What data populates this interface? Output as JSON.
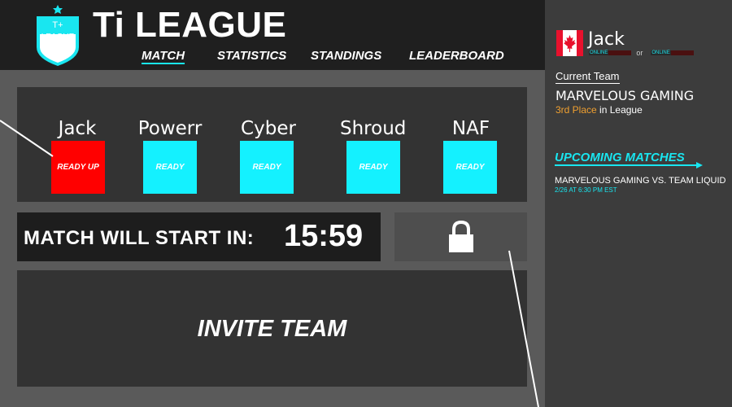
{
  "header": {
    "logo_top": "T+",
    "logo_text": "LEAGUE",
    "title": "Ti LEAGUE",
    "nav": {
      "match": "MATCH",
      "statistics": "STATISTICS",
      "standings": "STANDINGS",
      "leaderboard": "LEADERBOARD"
    }
  },
  "players": [
    {
      "name": "Jack",
      "status": "READY UP"
    },
    {
      "name": "Powerr",
      "status": "READY"
    },
    {
      "name": "Cyber",
      "status": "READY"
    },
    {
      "name": "Shroud",
      "status": "READY"
    },
    {
      "name": "NAF",
      "status": "READY"
    }
  ],
  "timer": {
    "label": "MATCH WILL START IN:",
    "value": "15:59"
  },
  "lock": {
    "icon": "lock-icon"
  },
  "invite": {
    "label": "INVITE TEAM"
  },
  "sidebar": {
    "user_name": "Jack",
    "flag_icon": "canada-flag-icon",
    "status_online": "ONLINE",
    "status_or": "or",
    "current_team_label": "Current Team",
    "team_name": "MARVELOUS GAMING",
    "team_place": "3rd Place",
    "team_place_suffix": "in League",
    "upcoming_label": "UPCOMING MATCHES",
    "match_title": "MARVELOUS GAMING VS. TEAM LIQUID",
    "match_time": "2/26 AT 6:30 PM EST"
  },
  "colors": {
    "accent": "#19e6f0",
    "ready": "#14f1ff",
    "not_ready": "#ff0000",
    "place": "#f0a030"
  }
}
